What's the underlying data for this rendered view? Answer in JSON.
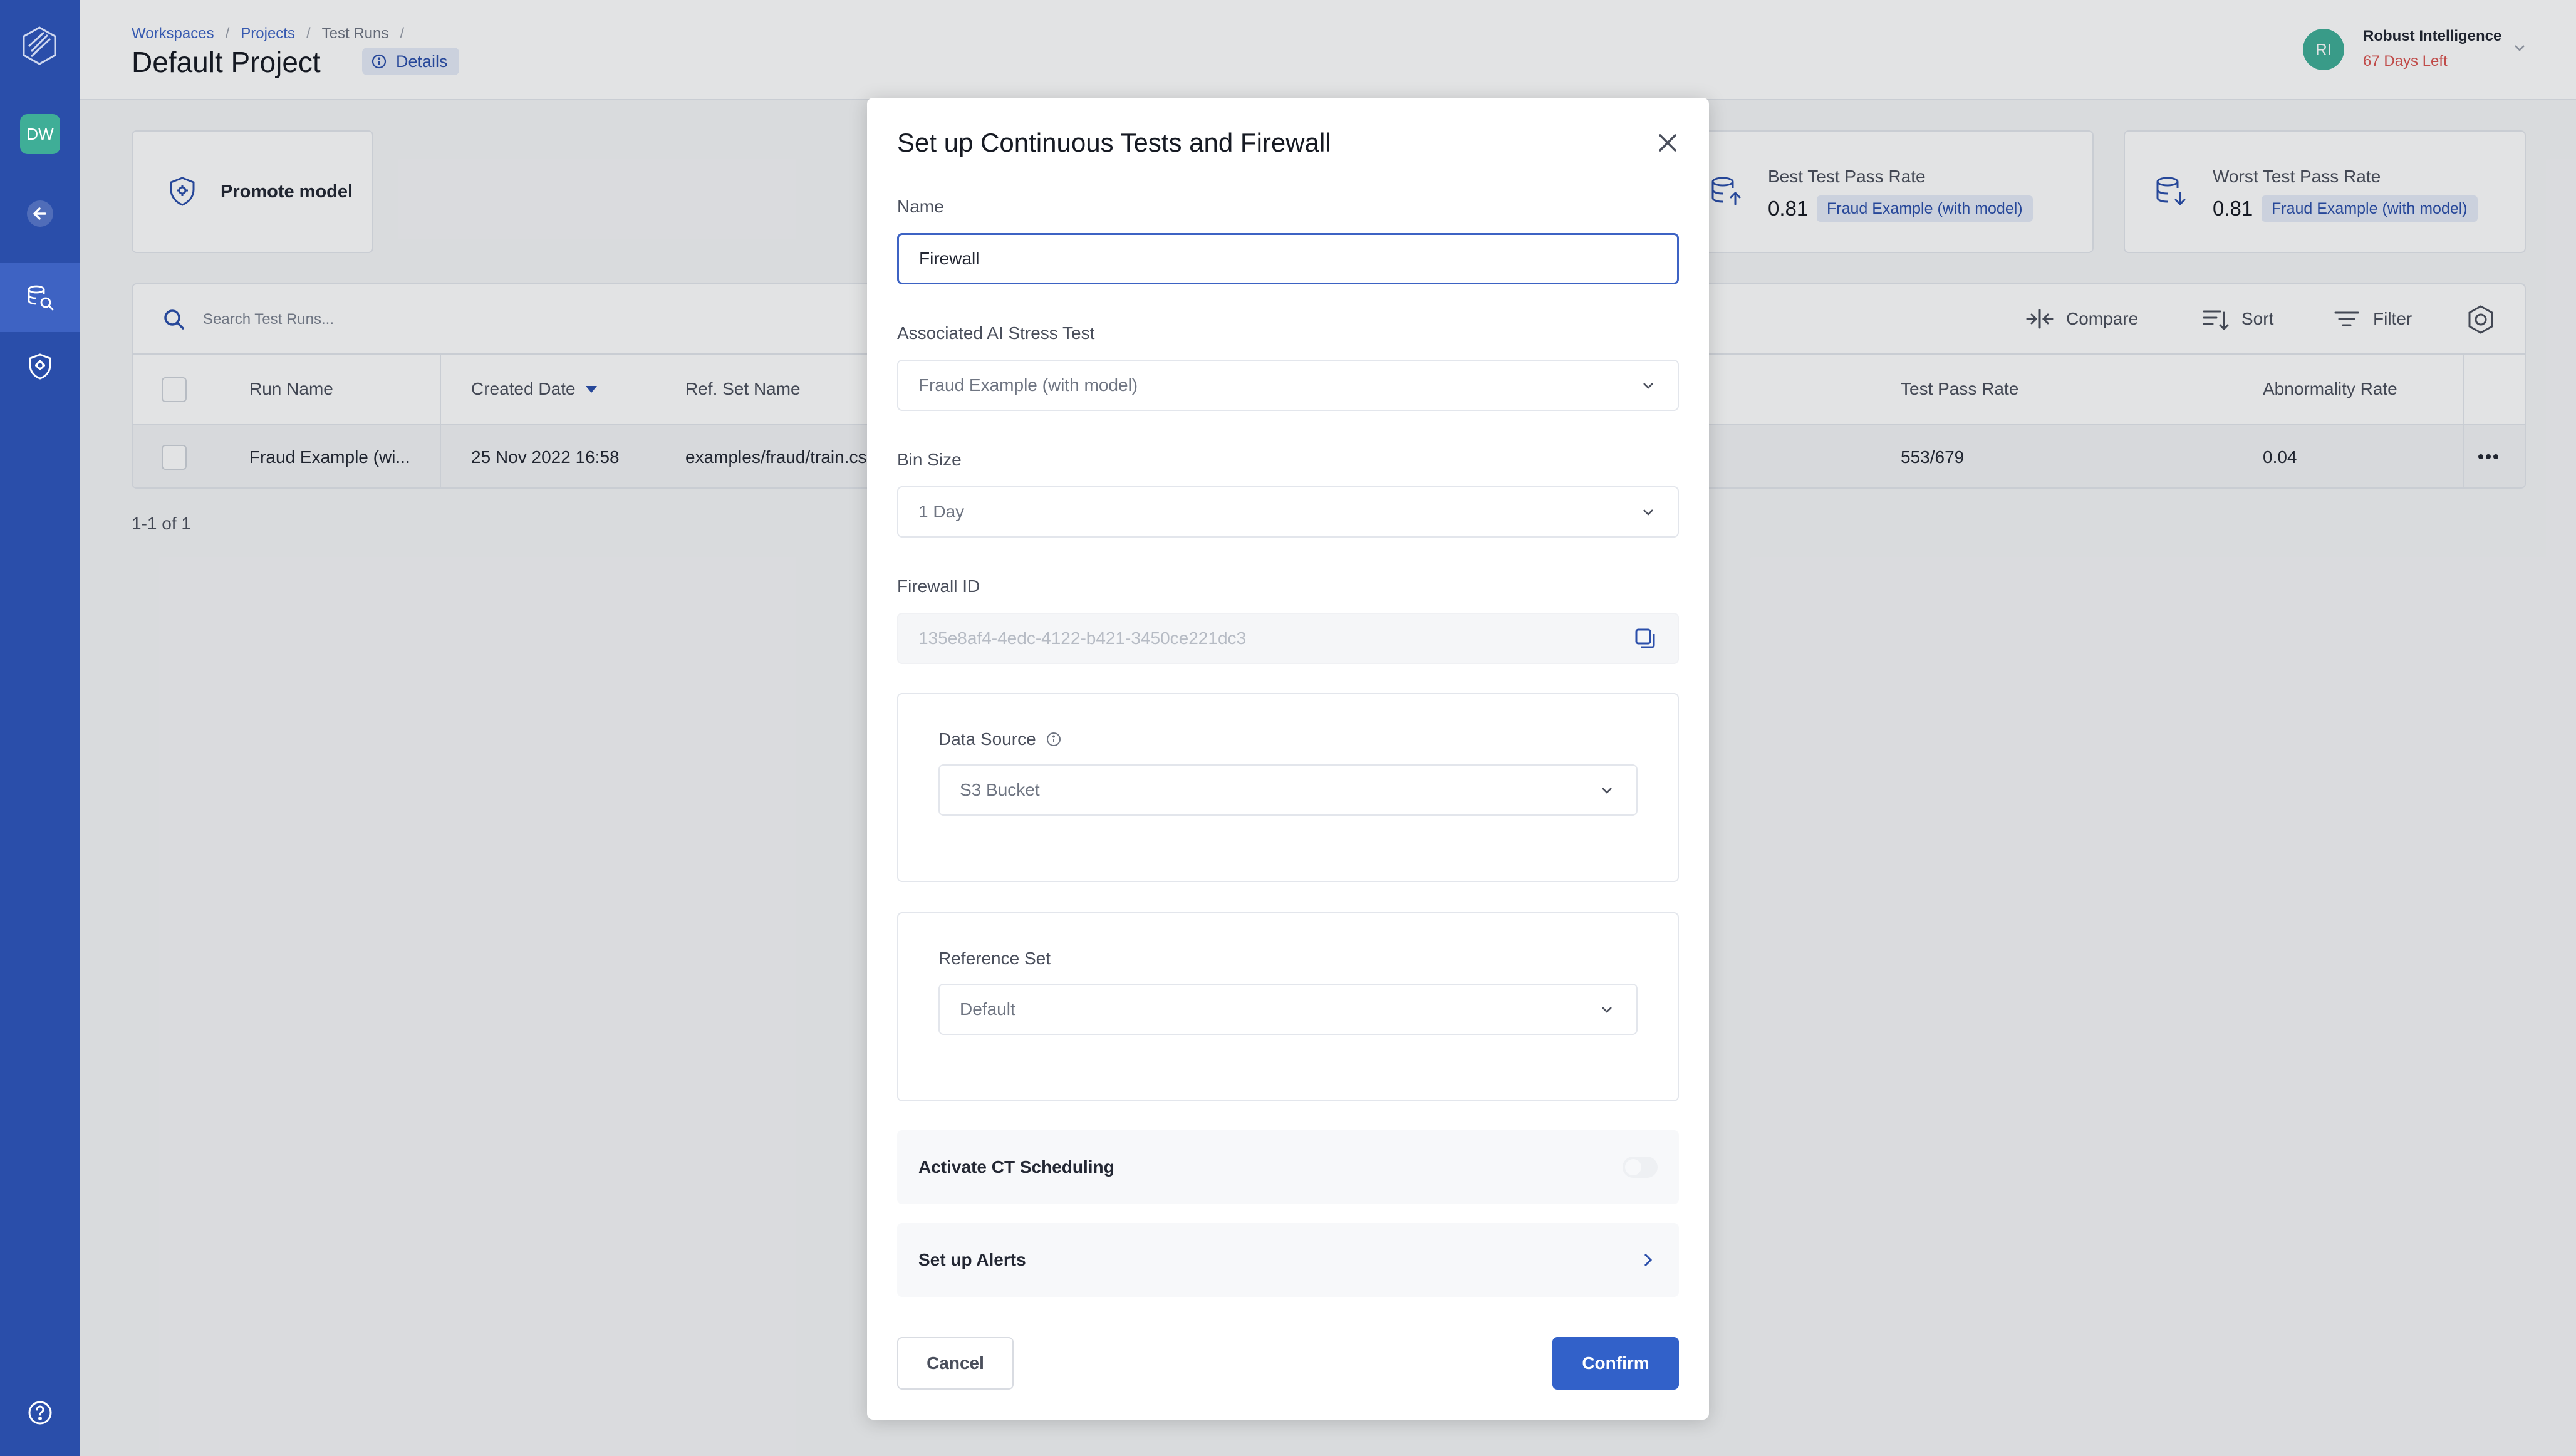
{
  "sidebar": {
    "avatar": "DW",
    "items": [
      {
        "icon": "back-arrow-icon"
      },
      {
        "icon": "test-runs-icon",
        "active": true
      },
      {
        "icon": "shield-icon"
      }
    ],
    "help_icon": "help-circle-icon"
  },
  "header": {
    "breadcrumb": [
      "Workspaces",
      "Projects",
      "Test Runs"
    ],
    "title": "Default Project",
    "details_label": "Details",
    "user_initials": "RI",
    "user_name": "Robust Intelligence",
    "user_days_left": "67 Days Left"
  },
  "cards": {
    "promote_label": "Promote model",
    "best": {
      "label": "Best Test Pass Rate",
      "value": "0.81",
      "tag": "Fraud Example (with model)"
    },
    "worst": {
      "label": "Worst Test Pass Rate",
      "value": "0.81",
      "tag": "Fraud Example (with model)"
    }
  },
  "toolbar": {
    "search_placeholder": "Search Test Runs...",
    "compare_label": "Compare",
    "sort_label": "Sort",
    "filter_label": "Filter"
  },
  "table": {
    "columns": [
      "Run Name",
      "Created Date",
      "Ref. Set Name",
      "Test Pass Rate",
      "Abnormality Rate"
    ],
    "rows": [
      {
        "run_name": "Fraud Example (wi...",
        "created": "25 Nov 2022 16:58",
        "ref_set": "examples/fraud/train.cs",
        "pass_rate": "553/679",
        "abnormality": "0.04"
      }
    ],
    "pagination": "1-1 of 1"
  },
  "modal": {
    "title": "Set up Continuous Tests and Firewall",
    "name_label": "Name",
    "name_value": "Firewall",
    "stress_test_label": "Associated AI Stress Test",
    "stress_test_value": "Fraud Example (with model)",
    "bin_size_label": "Bin Size",
    "bin_size_value": "1 Day",
    "firewall_id_label": "Firewall ID",
    "firewall_id_value": "135e8af4-4edc-4122-b421-3450ce221dc3",
    "data_source_label": "Data Source",
    "data_source_value": "S3 Bucket",
    "reference_set_label": "Reference Set",
    "reference_set_value": "Default",
    "ct_scheduling_label": "Activate CT Scheduling",
    "ct_scheduling_on": false,
    "alerts_label": "Set up Alerts",
    "cancel_label": "Cancel",
    "confirm_label": "Confirm"
  },
  "colors": {
    "sidebar": "#2a4eaa",
    "accent": "#3261c9",
    "avatar": "#3fae97",
    "warning_text": "#d9534f"
  }
}
